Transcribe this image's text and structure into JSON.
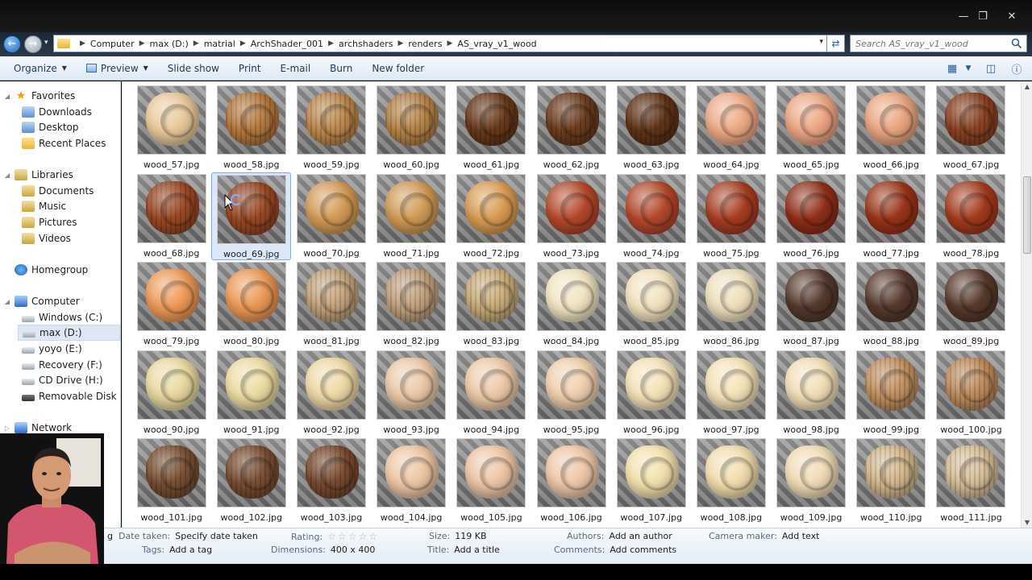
{
  "window": {
    "minimize": "—",
    "maximize": "❐",
    "close": "✕"
  },
  "address": {
    "crumbs": [
      "Computer",
      "max (D:)",
      "matrial",
      "ArchShader_001",
      "archshaders",
      "renders",
      "AS_vray_v1_wood"
    ],
    "search_placeholder": "Search AS_vray_v1_wood"
  },
  "toolbar": {
    "organize": "Organize",
    "preview": "Preview",
    "slideshow": "Slide show",
    "print": "Print",
    "email": "E-mail",
    "burn": "Burn",
    "new_folder": "New folder"
  },
  "nav": {
    "favorites": "Favorites",
    "favorites_items": [
      "Downloads",
      "Desktop",
      "Recent Places"
    ],
    "libraries": "Libraries",
    "libraries_items": [
      "Documents",
      "Music",
      "Pictures",
      "Videos"
    ],
    "homegroup": "Homegroup",
    "computer": "Computer",
    "computer_items": [
      "Windows (C:)",
      "max (D:)",
      "yoyo (E:)",
      "Recovery (F:)",
      "CD Drive (H:)",
      "Removable Disk (I:)"
    ],
    "network": "Network"
  },
  "files": [
    {
      "name": "wood_57.jpg",
      "color": "#e9c99a",
      "grain": false
    },
    {
      "name": "wood_58.jpg",
      "color": "#b77a3e",
      "grain": true
    },
    {
      "name": "wood_59.jpg",
      "color": "#bf8a4e",
      "grain": true
    },
    {
      "name": "wood_60.jpg",
      "color": "#b88549",
      "grain": true
    },
    {
      "name": "wood_61.jpg",
      "color": "#6b3a1c",
      "grain": true
    },
    {
      "name": "wood_62.jpg",
      "color": "#6e3d1f",
      "grain": true
    },
    {
      "name": "wood_63.jpg",
      "color": "#633518",
      "grain": true
    },
    {
      "name": "wood_64.jpg",
      "color": "#eeaa85",
      "grain": false
    },
    {
      "name": "wood_65.jpg",
      "color": "#eda684",
      "grain": false
    },
    {
      "name": "wood_66.jpg",
      "color": "#eaa680",
      "grain": false
    },
    {
      "name": "wood_67.jpg",
      "color": "#8c4322",
      "grain": true
    },
    {
      "name": "wood_68.jpg",
      "color": "#9c4a24",
      "grain": true
    },
    {
      "name": "wood_69.jpg",
      "color": "#9b4a25",
      "grain": true
    },
    {
      "name": "wood_70.jpg",
      "color": "#d39a55",
      "grain": false
    },
    {
      "name": "wood_71.jpg",
      "color": "#d09a56",
      "grain": false
    },
    {
      "name": "wood_72.jpg",
      "color": "#d99b52",
      "grain": false
    },
    {
      "name": "wood_73.jpg",
      "color": "#b4472a",
      "grain": false
    },
    {
      "name": "wood_74.jpg",
      "color": "#b3472a",
      "grain": false
    },
    {
      "name": "wood_75.jpg",
      "color": "#a63d22",
      "grain": false
    },
    {
      "name": "wood_76.jpg",
      "color": "#8f2e18",
      "grain": false
    },
    {
      "name": "wood_77.jpg",
      "color": "#9a3318",
      "grain": false
    },
    {
      "name": "wood_78.jpg",
      "color": "#a23a1d",
      "grain": false
    },
    {
      "name": "wood_79.jpg",
      "color": "#ef9a57",
      "grain": false
    },
    {
      "name": "wood_80.jpg",
      "color": "#eb9855",
      "grain": false
    },
    {
      "name": "wood_81.jpg",
      "color": "#c6a57e",
      "grain": true
    },
    {
      "name": "wood_82.jpg",
      "color": "#c3a37f",
      "grain": true
    },
    {
      "name": "wood_83.jpg",
      "color": "#cbae7c",
      "grain": true
    },
    {
      "name": "wood_84.jpg",
      "color": "#f2e4c2",
      "grain": false
    },
    {
      "name": "wood_85.jpg",
      "color": "#f2e2bf",
      "grain": false
    },
    {
      "name": "wood_86.jpg",
      "color": "#efe0bd",
      "grain": false
    },
    {
      "name": "wood_87.jpg",
      "color": "#54392c",
      "grain": false
    },
    {
      "name": "wood_88.jpg",
      "color": "#56392c",
      "grain": false
    },
    {
      "name": "wood_89.jpg",
      "color": "#57392b",
      "grain": false
    },
    {
      "name": "wood_90.jpg",
      "color": "#ead9a0",
      "grain": false
    },
    {
      "name": "wood_91.jpg",
      "color": "#eddca3",
      "grain": false
    },
    {
      "name": "wood_92.jpg",
      "color": "#efd9a6",
      "grain": false
    },
    {
      "name": "wood_93.jpg",
      "color": "#ecc9a8",
      "grain": false
    },
    {
      "name": "wood_94.jpg",
      "color": "#eec9a9",
      "grain": false
    },
    {
      "name": "wood_95.jpg",
      "color": "#f0cfae",
      "grain": false
    },
    {
      "name": "wood_96.jpg",
      "color": "#f4e2b9",
      "grain": false
    },
    {
      "name": "wood_97.jpg",
      "color": "#f5e3b8",
      "grain": false
    },
    {
      "name": "wood_98.jpg",
      "color": "#f2dfb7",
      "grain": false
    },
    {
      "name": "wood_99.jpg",
      "color": "#c39262",
      "grain": true
    },
    {
      "name": "wood_100.jpg",
      "color": "#c08d5e",
      "grain": true
    },
    {
      "name": "wood_101.jpg",
      "color": "#7a5033",
      "grain": true
    },
    {
      "name": "wood_102.jpg",
      "color": "#7b4f34",
      "grain": true
    },
    {
      "name": "wood_103.jpg",
      "color": "#7a4b31",
      "grain": true
    },
    {
      "name": "wood_104.jpg",
      "color": "#eec6a5",
      "grain": false
    },
    {
      "name": "wood_105.jpg",
      "color": "#eec6a6",
      "grain": false
    },
    {
      "name": "wood_106.jpg",
      "color": "#efc7a7",
      "grain": false
    },
    {
      "name": "wood_107.jpg",
      "color": "#f3e1ae",
      "grain": false
    },
    {
      "name": "wood_108.jpg",
      "color": "#f2ddae",
      "grain": false
    },
    {
      "name": "wood_109.jpg",
      "color": "#f1dcb6",
      "grain": false
    },
    {
      "name": "wood_110.jpg",
      "color": "#d5b98f",
      "grain": true
    },
    {
      "name": "wood_111.jpg",
      "color": "#d8c09a",
      "grain": true
    }
  ],
  "selected_file": "wood_69.jpg",
  "details": {
    "tag_label": "Tags:",
    "tag_value": "Add a tag",
    "date_label": "Date taken:",
    "date_value": "Specify date taken",
    "rating_label": "Rating:",
    "rating_stars": "☆☆☆☆☆",
    "rating_value": 0,
    "dimensions_label": "Dimensions:",
    "dimensions_value": "400 x 400",
    "size_label": "Size:",
    "size_value": "119 KB",
    "title_label": "Title:",
    "title_value": "Add a title",
    "authors_label": "Authors:",
    "authors_value": "Add an author",
    "comments_label": "Comments:",
    "comments_value": "Add comments",
    "camera_label": "Camera maker:",
    "camera_value": "Add text",
    "tag_prefix": "g"
  }
}
